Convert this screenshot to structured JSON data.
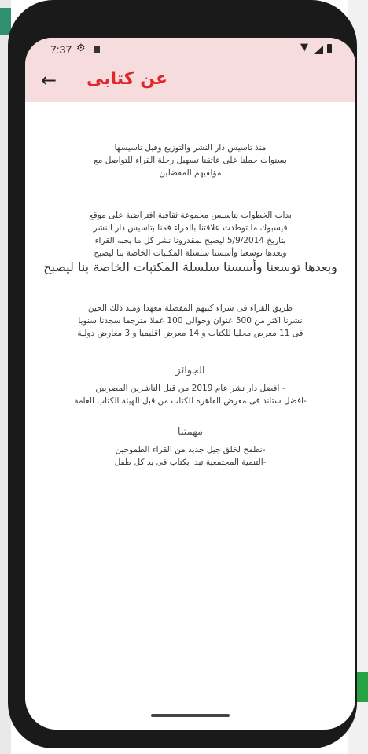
{
  "status_bar": {
    "time": "7:37",
    "icons": [
      "gear-icon",
      "sd-card-icon",
      "wifi-icon",
      "signal-icon",
      "battery-icon"
    ]
  },
  "app_bar": {
    "title": "عن كتابى",
    "back_icon": "←",
    "background": "#f6dcdc",
    "title_color": "#e0282c"
  },
  "about": {
    "intro": [
      "منذ تاسيس دار النشر والتوزيع وقبل تاسيسها",
      "بسنوات حملنا على عاتقنا تسهيل رحلة القراء للتواصل مع",
      "مؤلفيهم المفضلين"
    ],
    "beginning": [
      "بدات الخطوات بتاسيس مجموعة ثقافية افتراضية على موقع",
      "فيسبوك ما توطدت علاقتنا بالقراء فمنا بتاسيس دار النشر",
      "بتاريخ 5/9/2014 ليصبح بمقدرونا نشر كل ما يحبه القراء",
      "وبعدها توسعنا وأسسنا سلسلة المكتبات الخاصة بنا ليصبح"
    ],
    "highlight": "وبعدها توسعنا وأسسنا سلسلة المكتبات الخاصة بنا ليصبح",
    "stats": [
      "طريق القراء فى شراء كتبهم المفضلة معهدا ومنذ ذلك الحين",
      "نشرنا اكثر من 500 عنوان وحوالى 100 عملا مترجما سجدنا سنويا",
      "فى 11 معرض محليا للكتاب و 14 معرض اقليميا و 3 معارض دولية"
    ],
    "awards_heading": "الجوائز",
    "awards": [
      "- افضل دار نشر عام 2019 من قبل الناشرين المصريين",
      "-افضل ستاند فى معرض القاهرة للكتاب من قبل الهيئة الكتاب العامة"
    ],
    "mission_heading": "مهمتنا",
    "mission": [
      "-نطمح لخلق جيل جديد من القراء الطموحين",
      "-التنمية المجتمعية تبدا بكتاب فى يد كل طفل"
    ]
  }
}
